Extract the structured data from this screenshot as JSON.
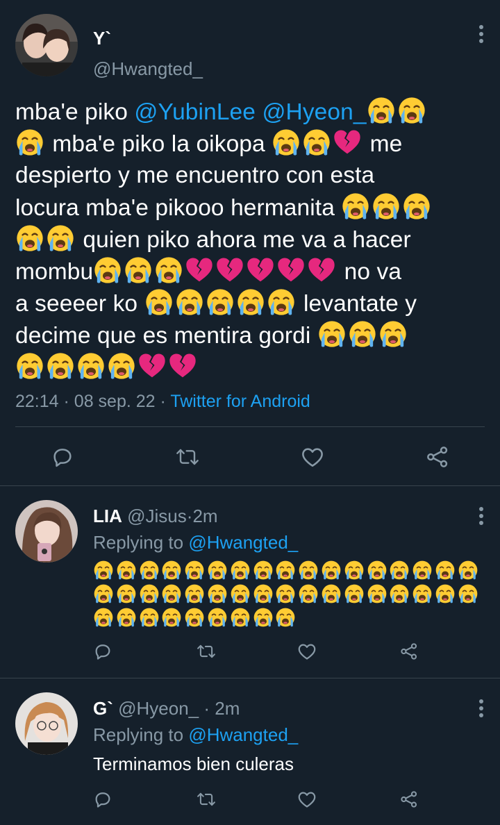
{
  "main_tweet": {
    "author_name": "Y`",
    "author_handle": "@Hwangted_",
    "lines": [
      [
        {
          "t": "text",
          "v": "mba'e piko "
        },
        {
          "t": "mention",
          "v": "@YubinLee"
        },
        {
          "t": "text",
          "v": " "
        },
        {
          "t": "mention",
          "v": "@Hyeon_"
        },
        {
          "t": "emoji",
          "v": "loudly-crying"
        },
        {
          "t": "emoji",
          "v": "loudly-crying"
        }
      ],
      [
        {
          "t": "emoji",
          "v": "loudly-crying"
        },
        {
          "t": "text",
          "v": " mba'e piko la oikopa "
        },
        {
          "t": "emoji",
          "v": "loudly-crying"
        },
        {
          "t": "emoji",
          "v": "loudly-crying"
        },
        {
          "t": "emoji",
          "v": "broken-heart"
        },
        {
          "t": "text",
          "v": " me"
        }
      ],
      [
        {
          "t": "text",
          "v": "despierto y me encuentro con esta"
        }
      ],
      [
        {
          "t": "text",
          "v": "locura mba'e pikooo hermanita "
        },
        {
          "t": "emoji",
          "v": "loudly-crying"
        },
        {
          "t": "emoji",
          "v": "loudly-crying"
        },
        {
          "t": "emoji",
          "v": "loudly-crying"
        }
      ],
      [
        {
          "t": "emoji",
          "v": "loudly-crying"
        },
        {
          "t": "emoji",
          "v": "loudly-crying"
        },
        {
          "t": "text",
          "v": " quien piko ahora me va a hacer"
        }
      ],
      [
        {
          "t": "text",
          "v": "mombu"
        },
        {
          "t": "emoji",
          "v": "loudly-crying"
        },
        {
          "t": "emoji",
          "v": "loudly-crying"
        },
        {
          "t": "emoji",
          "v": "loudly-crying"
        },
        {
          "t": "emoji",
          "v": "broken-heart"
        },
        {
          "t": "emoji",
          "v": "broken-heart"
        },
        {
          "t": "emoji",
          "v": "broken-heart"
        },
        {
          "t": "emoji",
          "v": "broken-heart"
        },
        {
          "t": "emoji",
          "v": "broken-heart"
        },
        {
          "t": "text",
          "v": " no va"
        }
      ],
      [
        {
          "t": "text",
          "v": "a seeeer ko "
        },
        {
          "t": "emoji",
          "v": "loudly-crying"
        },
        {
          "t": "emoji",
          "v": "loudly-crying"
        },
        {
          "t": "emoji",
          "v": "loudly-crying"
        },
        {
          "t": "emoji",
          "v": "loudly-crying"
        },
        {
          "t": "emoji",
          "v": "loudly-crying"
        },
        {
          "t": "text",
          "v": " levantate y"
        }
      ],
      [
        {
          "t": "text",
          "v": "decime que es mentira gordi "
        },
        {
          "t": "emoji",
          "v": "loudly-crying"
        },
        {
          "t": "emoji",
          "v": "loudly-crying"
        },
        {
          "t": "emoji",
          "v": "loudly-crying"
        }
      ],
      [
        {
          "t": "emoji",
          "v": "loudly-crying"
        },
        {
          "t": "emoji",
          "v": "loudly-crying"
        },
        {
          "t": "emoji",
          "v": "loudly-crying"
        },
        {
          "t": "emoji",
          "v": "loudly-crying"
        },
        {
          "t": "emoji",
          "v": "broken-heart"
        },
        {
          "t": "emoji",
          "v": "broken-heart"
        }
      ]
    ],
    "time": "22:14",
    "date": "08 sep. 22",
    "separator": "·",
    "source": "Twitter for Android"
  },
  "replies": [
    {
      "name": "LIA",
      "handle": "@Jisus",
      "separator": "·",
      "age": "2m",
      "replying_label": "Replying to",
      "replying_to": "@Hwangted_",
      "emoji_rows": [
        17,
        17,
        9
      ],
      "emoji": "loudly-crying"
    },
    {
      "name": "G`",
      "handle": "@Hyeon_",
      "separator": "·",
      "age": "2m",
      "replying_label": "Replying to",
      "replying_to": "@Hwangted_",
      "text": "Terminamos bien culeras"
    }
  ],
  "icons": {
    "reply": "reply-icon",
    "retweet": "retweet-icon",
    "like": "heart-icon",
    "share": "share-icon",
    "more": "more-vertical-icon"
  },
  "colors": {
    "background": "#15202b",
    "text": "#ffffff",
    "secondary": "#8899a6",
    "accent": "#1da1f2",
    "divider": "#38444d"
  }
}
